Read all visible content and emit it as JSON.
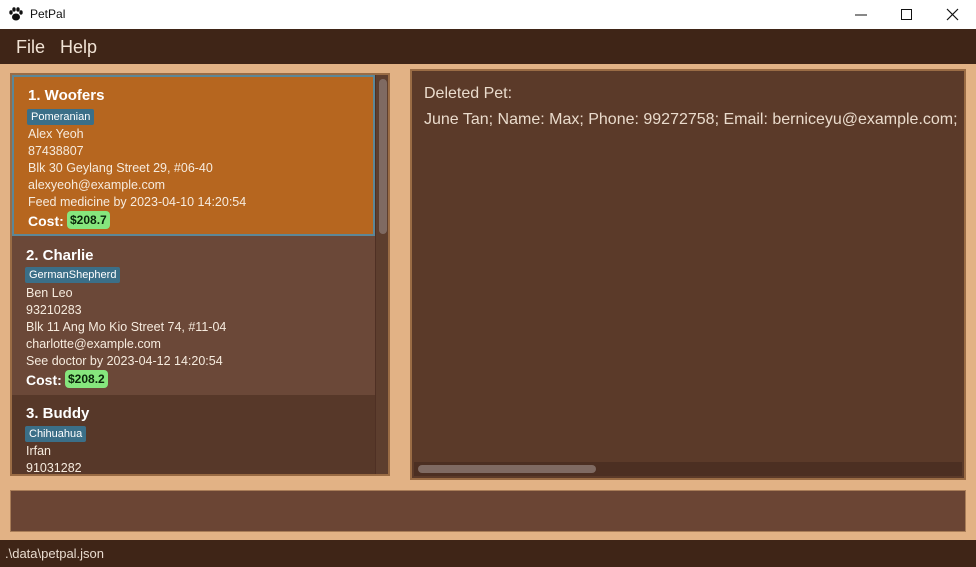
{
  "window": {
    "title": "PetPal",
    "icon": "paw-icon"
  },
  "menu": {
    "file": "File",
    "help": "Help"
  },
  "pets": [
    {
      "title": "1.  Woofers",
      "breed": "Pomeranian",
      "owner": "Alex Yeoh",
      "phone": "87438807",
      "address": "Blk 30 Geylang Street 29, #06-40",
      "email": "alexyeoh@example.com",
      "reminder": "Feed medicine by 2023-04-10 14:20:54",
      "cost_label": "Cost:",
      "cost": "$208.7"
    },
    {
      "title": "2.  Charlie",
      "breed": "GermanShepherd",
      "owner": "Ben Leo",
      "phone": "93210283",
      "address": "Blk 11 Ang Mo Kio Street 74, #11-04",
      "email": "charlotte@example.com",
      "reminder": "See doctor by 2023-04-12 14:20:54",
      "cost_label": "Cost:",
      "cost": "$208.2"
    },
    {
      "title": "3.  Buddy",
      "breed": "Chihuahua",
      "owner": "Irfan",
      "phone": "91031282"
    }
  ],
  "result": {
    "line1": "Deleted Pet:",
    "line2": "June Tan; Name: Max; Phone: 99272758; Email: berniceyu@example.com;"
  },
  "command": {
    "value": ""
  },
  "status": {
    "path": ".\\data\\petpal.json"
  },
  "colors": {
    "selected_card": "#b6661f",
    "tag": "#3b6f88",
    "cost_badge": "#86e67d",
    "menubar": "#3f2517"
  }
}
